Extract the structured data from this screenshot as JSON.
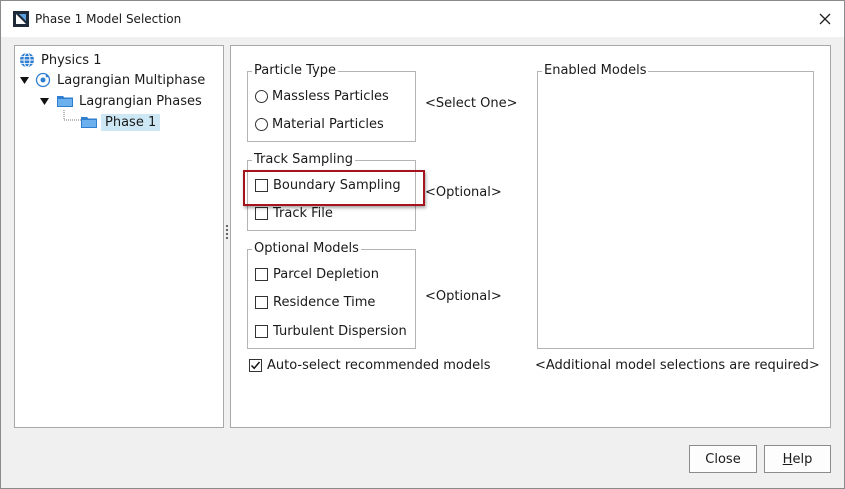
{
  "window": {
    "title": "Phase 1 Model Selection",
    "close_glyph": "✕"
  },
  "tree": {
    "nodes": [
      {
        "label": "Physics 1",
        "icon": "globe-icon"
      },
      {
        "label": "Lagrangian Multiphase",
        "icon": "multiphase-icon"
      },
      {
        "label": "Lagrangian Phases",
        "icon": "folder-icon"
      },
      {
        "label": "Phase 1",
        "icon": "folder-icon",
        "selected": true
      }
    ]
  },
  "particle_type": {
    "title": "Particle Type",
    "options": [
      {
        "label": "Massless Particles",
        "checked": false
      },
      {
        "label": "Material Particles",
        "checked": false
      }
    ],
    "hint": "<Select One>"
  },
  "track_sampling": {
    "title": "Track Sampling",
    "options": [
      {
        "label": "Boundary Sampling",
        "checked": false
      },
      {
        "label": "Track File",
        "checked": false
      }
    ],
    "hint": "<Optional>"
  },
  "optional_models": {
    "title": "Optional Models",
    "options": [
      {
        "label": "Parcel Depletion",
        "checked": false
      },
      {
        "label": "Residence Time",
        "checked": false
      },
      {
        "label": "Turbulent Dispersion",
        "checked": false
      }
    ],
    "hint": "<Optional>"
  },
  "auto_select": {
    "label": "Auto-select recommended models",
    "checked": true
  },
  "enabled_models": {
    "title": "Enabled Models"
  },
  "status": "<Additional model selections are required>",
  "buttons": {
    "close": "Close",
    "help_mnemonic": "H",
    "help_rest": "elp"
  },
  "colors": {
    "highlight_border": "#a5141c",
    "selection": "#cde8f4",
    "icon_blue": "#2f7fd1"
  }
}
